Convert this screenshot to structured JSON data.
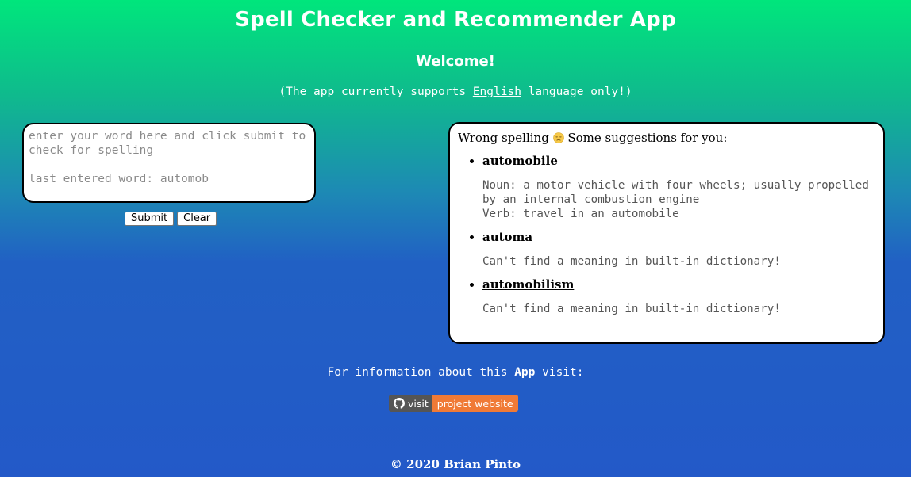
{
  "header": {
    "title": "Spell Checker and Recommender App",
    "welcome": "Welcome!",
    "support_prefix": "(The app currently supports ",
    "support_link": "English",
    "support_suffix": " language only!)"
  },
  "input_panel": {
    "placeholder": "enter your word here and click submit to check for spelling\n\nlast entered word: automob",
    "submit_label": "Submit",
    "clear_label": "Clear"
  },
  "results_panel": {
    "heading_prefix": "Wrong spelling",
    "heading_icon": "sad-face-icon",
    "heading_suffix": " Some suggestions for you:",
    "suggestions": [
      {
        "word": "automobile",
        "meaning": "Noun: a motor vehicle with four wheels; usually propelled by an internal combustion engine\nVerb: travel in an automobile"
      },
      {
        "word": "automa",
        "meaning": "Can't find a meaning in built-in dictionary!"
      },
      {
        "word": "automobilism",
        "meaning": "Can't find a meaning in built-in dictionary!"
      }
    ]
  },
  "info": {
    "prefix": "For information about this ",
    "app_word": "App",
    "suffix": " visit:"
  },
  "badge": {
    "icon": "github-icon",
    "left_label": "visit",
    "right_label": "project website",
    "left_color": "#555555",
    "right_color": "#f07a36"
  },
  "footer": {
    "copyright": "© 2020 Brian Pinto"
  },
  "colors": {
    "gradient_top": "#00e67c",
    "gradient_bottom": "#2359c8"
  }
}
